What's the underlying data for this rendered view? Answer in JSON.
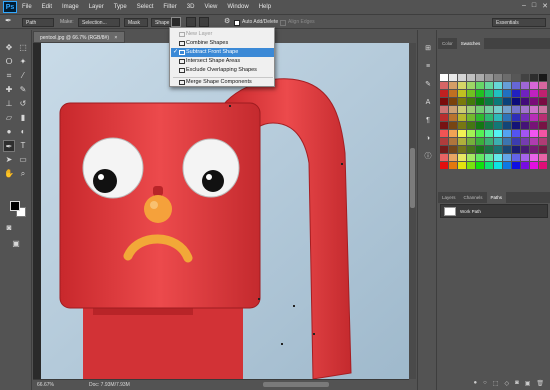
{
  "menubar": {
    "logo": "Ps",
    "items": [
      "File",
      "Edit",
      "Image",
      "Layer",
      "Type",
      "Select",
      "Filter",
      "3D",
      "View",
      "Window",
      "Help"
    ],
    "controls": [
      "–",
      "□",
      "✕"
    ]
  },
  "options": {
    "path_mode": "Path",
    "make_label": "Make:",
    "selection_btn": "Selection...",
    "mask_btn": "Mask",
    "shape_btn": "Shape",
    "auto_add_delete": "Auto Add/Delete",
    "align_edges": "Align Edges",
    "workspace": "Essentials"
  },
  "document": {
    "tab_title": "pentool.jpg @ 66.7% (RGB/8#)",
    "tab_close": "×",
    "zoom": "66.67%",
    "doc_info": "Doc: 7.93M/7.93M"
  },
  "dropdown": {
    "items": [
      {
        "label": "New Layer",
        "state": "disabled"
      },
      {
        "label": "Combine Shapes",
        "state": "normal"
      },
      {
        "label": "Subtract Front Shape",
        "state": "selected",
        "checked": "✓"
      },
      {
        "label": "Intersect Shape Areas",
        "state": "normal"
      },
      {
        "label": "Exclude Overlapping Shapes",
        "state": "normal"
      },
      {
        "label": "Merge Shape Components",
        "state": "normal"
      }
    ]
  },
  "panels": {
    "color_tabs": [
      "Color",
      "Swatches"
    ],
    "layer_tabs": [
      "Layers",
      "Channels",
      "Paths"
    ],
    "work_path": "Work Path"
  },
  "colors": {
    "fg": "#000000",
    "bg": "#ffffff",
    "robot_red": "#e8484a",
    "highlight": "#3b89d6"
  }
}
